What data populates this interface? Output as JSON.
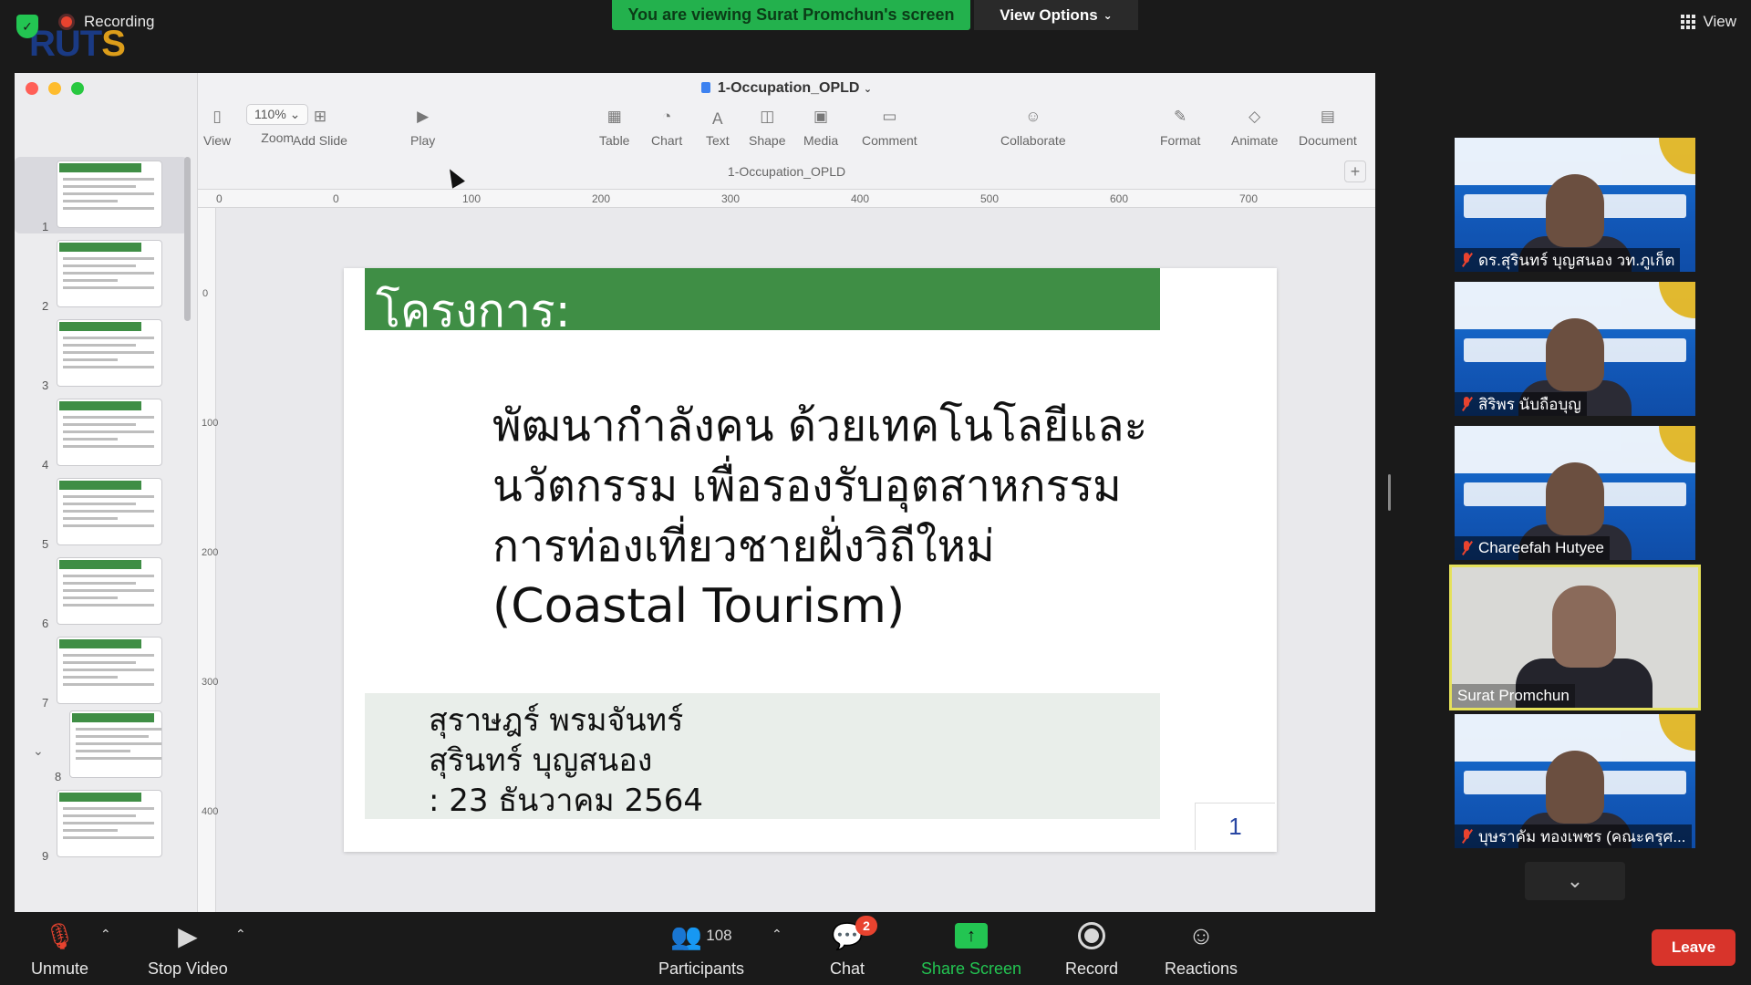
{
  "top_bar": {
    "recording_label": "Recording",
    "viewing_banner": "You are viewing Surat Promchun's screen",
    "view_options_label": "View Options",
    "view_label": "View",
    "logo_text_main": "RUT",
    "logo_text_accent": "S"
  },
  "keynote": {
    "doc_title": "1-Occupation_OPLD",
    "doc_subtitle": "1-Occupation_OPLD",
    "zoom_value": "110%",
    "toolbar": [
      {
        "label": "View",
        "icon": "sidebar-icon"
      },
      {
        "label": "Zoom",
        "icon": "zoom-icon"
      },
      {
        "label": "Add Slide",
        "icon": "add-slide-icon"
      },
      {
        "label": "Play",
        "icon": "play-icon"
      },
      {
        "label": "Table",
        "icon": "table-icon"
      },
      {
        "label": "Chart",
        "icon": "chart-icon"
      },
      {
        "label": "Text",
        "icon": "text-icon"
      },
      {
        "label": "Shape",
        "icon": "shape-icon"
      },
      {
        "label": "Media",
        "icon": "media-icon"
      },
      {
        "label": "Comment",
        "icon": "comment-icon"
      },
      {
        "label": "Collaborate",
        "icon": "collaborate-icon"
      },
      {
        "label": "Format",
        "icon": "format-icon"
      },
      {
        "label": "Animate",
        "icon": "animate-icon"
      },
      {
        "label": "Document",
        "icon": "document-icon"
      }
    ],
    "ruler_top": [
      "0",
      "0",
      "100",
      "200",
      "300",
      "400",
      "500",
      "600",
      "700"
    ],
    "ruler_left": [
      "0",
      "100",
      "200",
      "300",
      "400"
    ],
    "thumbnails": [
      "1",
      "2",
      "3",
      "4",
      "5",
      "6",
      "7",
      "8",
      "9"
    ],
    "selected_slide": "1"
  },
  "slide": {
    "title": "โครงการ:",
    "body_lines": [
      "พัฒนากำลังคน ด้วยเทคโนโลยีและ",
      "นวัตกรรม เพื่อรองรับอุตสาหกรรม",
      "การท่องเที่ยวชายฝั่งวิถีใหม่"
    ],
    "body_en": "(Coastal Tourism)",
    "authors": [
      "สุราษฎร์ พรมจันทร์",
      "สุรินทร์ บุญสนอง",
      ": 23 ธันวาคม 2564"
    ],
    "page_number": "1"
  },
  "participants_tiles": [
    {
      "name": "ดร.สุรินทร์ บุญสนอง วท.ภูเก็ต",
      "muted": true
    },
    {
      "name": "สิริพร นับถือบุญ",
      "muted": true
    },
    {
      "name": "Chareefah Hutyee",
      "muted": true
    },
    {
      "name": "Surat Promchun",
      "muted": false,
      "active": true
    },
    {
      "name": "บุษราคัม ทองเพชร (คณะครุศ...",
      "muted": true
    }
  ],
  "bottom_bar": {
    "unmute": "Unmute",
    "stop_video": "Stop Video",
    "participants": "Participants",
    "participant_count": "108",
    "chat": "Chat",
    "chat_badge": "2",
    "share_screen": "Share Screen",
    "record": "Record",
    "reactions": "Reactions",
    "leave": "Leave"
  },
  "colors": {
    "zoom_green": "#23b14d",
    "slide_green": "#3f8e45",
    "leave_red": "#d8342b",
    "active_speaker": "#e5e15a"
  }
}
